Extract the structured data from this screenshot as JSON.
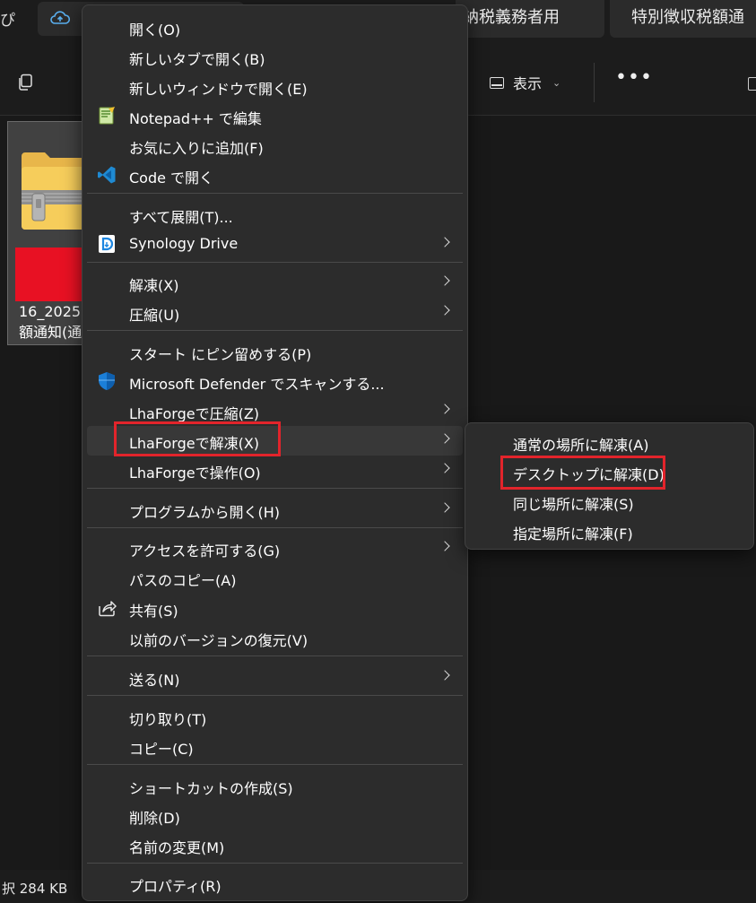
{
  "window": {
    "left_edge_glyph": "ぴ",
    "tabs": [
      {
        "label": "納税義務者用"
      },
      {
        "label": "特別徴収税額通"
      }
    ]
  },
  "toolbar": {
    "view_label": "表示",
    "more_label": "•••"
  },
  "file": {
    "name_line1": "16_2025",
    "name_line2": "額通知(通"
  },
  "status": {
    "text": "択  284 KB"
  },
  "context_menu": {
    "items": [
      {
        "label": "開く(O)"
      },
      {
        "label": "新しいタブで開く(B)"
      },
      {
        "label": "新しいウィンドウで開く(E)"
      },
      {
        "label": "Notepad++ で編集",
        "icon": "notepadpp-icon"
      },
      {
        "label": "お気に入りに追加(F)"
      },
      {
        "label": "Code で開く",
        "icon": "vscode-icon"
      },
      {
        "label": "すべて展開(T)..."
      },
      {
        "label": "Synology Drive",
        "icon": "synology-drive-icon"
      },
      {
        "label": "解凍(X)"
      },
      {
        "label": "圧縮(U)"
      },
      {
        "label": "スタート にピン留めする(P)"
      },
      {
        "label": "Microsoft Defender でスキャンする...",
        "icon": "defender-shield-icon"
      },
      {
        "label": "LhaForgeで圧縮(Z)"
      },
      {
        "label": "LhaForgeで解凍(X)"
      },
      {
        "label": "LhaForgeで操作(O)"
      },
      {
        "label": "プログラムから開く(H)"
      },
      {
        "label": "アクセスを許可する(G)"
      },
      {
        "label": "パスのコピー(A)"
      },
      {
        "label": "共有(S)",
        "icon": "share-icon"
      },
      {
        "label": "以前のバージョンの復元(V)"
      },
      {
        "label": "送る(N)"
      },
      {
        "label": "切り取り(T)"
      },
      {
        "label": "コピー(C)"
      },
      {
        "label": "ショートカットの作成(S)"
      },
      {
        "label": "削除(D)"
      },
      {
        "label": "名前の変更(M)"
      },
      {
        "label": "プロパティ(R)"
      }
    ]
  },
  "submenu": {
    "items": [
      {
        "label": "通常の場所に解凍(A)"
      },
      {
        "label": "デスクトップに解凍(D)"
      },
      {
        "label": "同じ場所に解凍(S)"
      },
      {
        "label": "指定場所に解凍(F)"
      }
    ]
  },
  "colors": {
    "highlight_box": "#e2242b",
    "menu_bg": "#2c2c2c",
    "hover_bg": "#383838"
  }
}
